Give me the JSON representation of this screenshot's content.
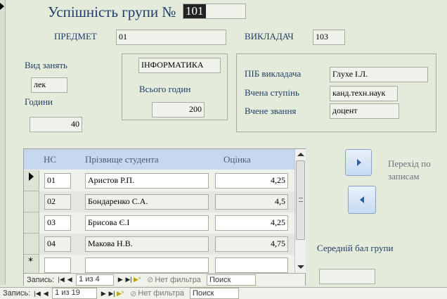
{
  "header": {
    "title": "Успішність групи №",
    "group_no": "101"
  },
  "subject": {
    "label": "ПРЕДМЕТ",
    "value": "01"
  },
  "teacher": {
    "label": "ВИКЛАДАЧ",
    "value": "103"
  },
  "lesson_type": {
    "label": "Вид занять",
    "value": "лек"
  },
  "hours": {
    "label": "Години",
    "value": "40"
  },
  "course": {
    "name": "ІНФОРМАТИКА",
    "total_label": "Всього годин",
    "total_value": "200"
  },
  "teacher_info": {
    "name_label": "ПІБ викладача",
    "name_value": "Глухе І.Л.",
    "degree_label": "Вчена ступінь",
    "degree_value": "канд.техн.наук",
    "rank_label": "Вчене звання",
    "rank_value": "доцент"
  },
  "nav_hint": "Перехід по записам",
  "avg_label": "Середній бал групи",
  "grid": {
    "columns": [
      "НС",
      "Прізвище студента",
      "Оцінка"
    ],
    "rows": [
      {
        "ns": "01",
        "name": "Аристов Р.П.",
        "grade": "4,25"
      },
      {
        "ns": "02",
        "name": "Бондаренко С.А.",
        "grade": "4,5"
      },
      {
        "ns": "03",
        "name": "Брисова Є.І",
        "grade": "4,25"
      },
      {
        "ns": "04",
        "name": "Макова Н.В.",
        "grade": "4,75"
      }
    ]
  },
  "sub_nav": {
    "label": "Запись:",
    "position": "1 из 4",
    "filter": "Нет фильтра",
    "search": "Поиск"
  },
  "main_nav": {
    "label": "Запись:",
    "position": "1 из 19",
    "filter": "Нет фильтра",
    "search": "Поиск"
  }
}
